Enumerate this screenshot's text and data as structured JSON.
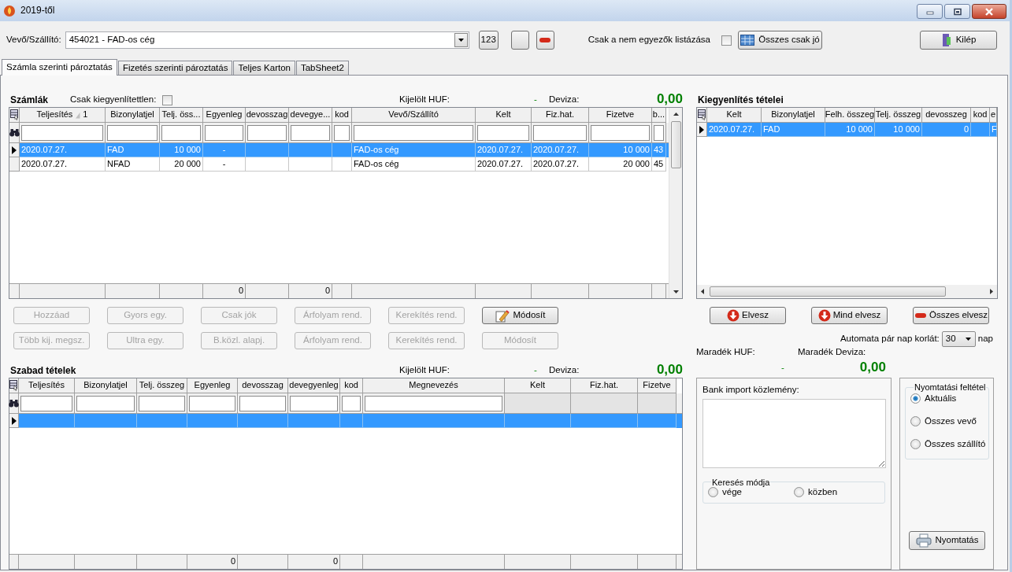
{
  "window": {
    "title": "2019-től"
  },
  "toolbar": {
    "partner_label": "Vevő/Szállító:",
    "partner_value": "454021 - FAD-os cég",
    "number_button": "123",
    "mismatch_label": "Csak a nem egyezők listázása",
    "mismatch_checked": false,
    "all_ok_button": "Összes csak jó",
    "exit_button": "Kilép"
  },
  "tabs": [
    {
      "label": "Számla szerinti pároztatás",
      "selected": true
    },
    {
      "label": "Fizetés szerinti pároztatás",
      "selected": false
    },
    {
      "label": "Teljes Karton",
      "selected": false
    },
    {
      "label": "TabSheet2",
      "selected": false
    }
  ],
  "invoices": {
    "title": "Számlák",
    "unsettled_label": "Csak kiegyenlítettlen:",
    "unsettled_checked": false,
    "selected_huf_label": "Kijelölt HUF:",
    "selected_huf_value": "-",
    "currency_label": "Deviza:",
    "currency_value": "0,00",
    "columns": [
      {
        "label": "Teljesítés",
        "sort_order": "1",
        "kind": "text"
      },
      {
        "label": "Bizonylatjel",
        "kind": "text"
      },
      {
        "label": "Telj. öss...",
        "kind": "number"
      },
      {
        "label": "Egyenleg",
        "kind": "center",
        "total": "0"
      },
      {
        "label": "devosszag",
        "kind": "number"
      },
      {
        "label": "devegye...",
        "kind": "number",
        "total": "0"
      },
      {
        "label": "kod",
        "kind": "text"
      },
      {
        "label": "Vevő/Szállító",
        "kind": "text"
      },
      {
        "label": "Kelt",
        "kind": "text"
      },
      {
        "label": "Fiz.hat.",
        "kind": "text"
      },
      {
        "label": "Fizetve",
        "kind": "number"
      },
      {
        "label": "b...",
        "kind": "text"
      }
    ],
    "rows": [
      {
        "selected": true,
        "cells": [
          "2020.07.27.",
          "FAD",
          "10 000",
          "-",
          "",
          "",
          "",
          "FAD-os cég",
          "2020.07.27.",
          "2020.07.27.",
          "10 000",
          "43"
        ]
      },
      {
        "selected": false,
        "cells": [
          "2020.07.27.",
          "NFAD",
          "20 000",
          "-",
          "",
          "",
          "",
          "FAD-os cég",
          "2020.07.27.",
          "2020.07.27.",
          "20 000",
          "45"
        ]
      }
    ]
  },
  "action_buttons": [
    {
      "label": "Hozzáad",
      "disabled": true
    },
    {
      "label": "Gyors egy.",
      "disabled": true
    },
    {
      "label": "Csak jók",
      "disabled": true
    },
    {
      "label": "Árfolyam rend.",
      "disabled": true
    },
    {
      "label": "Kerekítés rend.",
      "disabled": true
    },
    {
      "label": "Módosít",
      "disabled": false
    },
    {
      "label": "Több kij. megsz.",
      "disabled": true
    },
    {
      "label": "Ultra egy.",
      "disabled": true
    },
    {
      "label": "B.közl. alapj.",
      "disabled": true
    },
    {
      "label": "Árfolyam rend.",
      "disabled": true
    },
    {
      "label": "Kerekítés rend.",
      "disabled": true
    },
    {
      "label": "Módosít",
      "disabled": true
    }
  ],
  "free_items": {
    "title": "Szabad tételek",
    "selected_huf_label": "Kijelölt HUF:",
    "selected_huf_value": "-",
    "currency_label": "Deviza:",
    "currency_value": "0,00",
    "columns": [
      {
        "label": "Teljesítés",
        "filter": true
      },
      {
        "label": "Bizonylatjel",
        "filter": true
      },
      {
        "label": "Telj. összeg",
        "filter": true
      },
      {
        "label": "Egyenleg",
        "filter": true,
        "total": "0"
      },
      {
        "label": "devosszag",
        "filter": true
      },
      {
        "label": "devegyenleg",
        "filter": true,
        "total": "0"
      },
      {
        "label": "kod",
        "filter": true
      },
      {
        "label": "Megnevezés",
        "filter": true
      },
      {
        "label": "Kelt",
        "filter": false
      },
      {
        "label": "Fiz.hat.",
        "filter": false
      },
      {
        "label": "Fizetve",
        "filter": false
      }
    ],
    "rows": [
      {
        "selected": true
      }
    ]
  },
  "settlement": {
    "title": "Kiegyenlítés tételei",
    "columns": [
      {
        "label": "Kelt",
        "kind": "text"
      },
      {
        "label": "Bizonylatjel",
        "kind": "text"
      },
      {
        "label": "Felh. összeg",
        "kind": "number"
      },
      {
        "label": "Telj. összeg",
        "kind": "number"
      },
      {
        "label": "devosszeg",
        "kind": "number"
      },
      {
        "label": "kod",
        "kind": "text"
      },
      {
        "label": "e",
        "kind": "text"
      }
    ],
    "rows": [
      {
        "selected": true,
        "cells": [
          "2020.07.27.",
          "FAD",
          "10 000",
          "10 000",
          "0",
          "",
          "F"
        ]
      }
    ]
  },
  "settlement_buttons": [
    {
      "label": "Elvesz"
    },
    {
      "label": "Mind elvesz"
    },
    {
      "label": "Összes elvesz"
    }
  ],
  "auto_pair": {
    "label": "Automata pár nap korlát:",
    "value": "30",
    "unit": "nap"
  },
  "remaining": {
    "huf_label": "Maradék HUF:",
    "huf_value": "-",
    "currency_label": "Maradék Deviza:",
    "currency_value": "0,00"
  },
  "bank_import": {
    "label": "Bank import közlemény:",
    "search_mode": {
      "title": "Keresés módja",
      "options": [
        {
          "label": "vége",
          "selected": false
        },
        {
          "label": "közben",
          "selected": false
        }
      ]
    }
  },
  "print": {
    "title": "Nyomtatási feltétel",
    "options": [
      {
        "label": "Aktuális",
        "selected": true
      },
      {
        "label": "Összes vevő",
        "selected": false
      },
      {
        "label": "Összes szállító",
        "selected": false
      }
    ],
    "button": "Nyomtatás"
  }
}
